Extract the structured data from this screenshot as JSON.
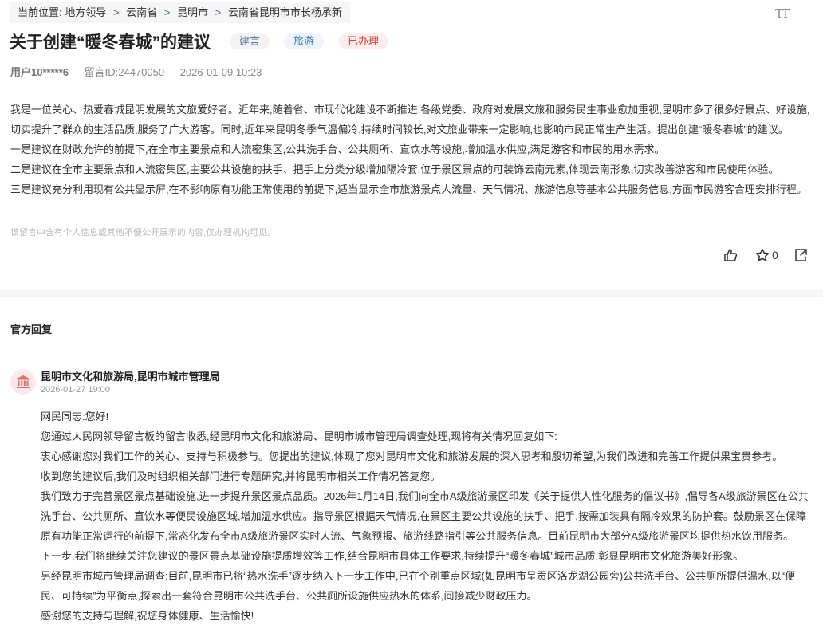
{
  "breadcrumb": {
    "label": "当前位置:",
    "items": [
      "地方领导",
      "云南省",
      "昆明市",
      "云南省昆明市市长杨承新"
    ],
    "separator": ">"
  },
  "font_toggle": "TT",
  "post": {
    "title": "关于创建“暖冬春城”的建议",
    "tags": [
      "建言",
      "旅游",
      "已办理"
    ],
    "user": "用户10*****6",
    "message_id": "留言ID:24470050",
    "datetime": "2026-01-09 10:23",
    "paragraphs": [
      "我是一位关心、热爱春城昆明发展的文旅爱好者。近年来,随着省、市现代化建设不断推进,各级党委、政府对发展文旅和服务民生事业愈加重视,昆明市多了很多好景点、好设施,切实提升了群众的生活品质,服务了广大游客。同时,近年来昆明冬季气温偏冷,持续时间较长,对文旅业带来一定影响,也影响市民正常生产生活。提出创建“暖冬春城”的建议。",
      "一是建议在财政允许的前提下,在全市主要景点和人流密集区,公共洗手台、公共厕所、直饮水等设施,增加温水供应,满足游客和市民的用水需求。",
      "二是建议在全市主要景点和人流密集区,主要公共设施的扶手、把手上分类分级增加隔冷套,位于景区景点的可装饰云南元素,体现云南形象,切实改善游客和市民使用体验。",
      "三是建议充分利用现有公共显示屏,在不影响原有功能正常使用的前提下,适当显示全市旅游景点人流量、天气情况、旅游信息等基本公共服务信息,方面市民游客合理安排行程。"
    ],
    "notice": "该留言中含有个人信息或其他不便公开展示的内容,仅办理机构可见。",
    "star_count": "0"
  },
  "reply": {
    "section_title": "官方回复",
    "org": "昆明市文化和旅游局,昆明市城市管理局",
    "datetime": "2026-01-27 19:00",
    "paragraphs": [
      "网民同志:您好!",
      "您通过人民网领导留言板的留言收悉,经昆明市文化和旅游局、昆明市城市管理局调查处理,现将有关情况回复如下:",
      "衷心感谢您对我们工作的关心、支持与积极参与。您提出的建议,体现了您对昆明市文化和旅游发展的深入思考和殷切希望,为我们改进和完善工作提供果宝贵参考。",
      "收到您的建议后,我们及时组织相关部门进行专题研究,并将昆明市相关工作情况答复您。",
      "我们致力于完善景区景点基础设施,进一步提升景区景点品质。2026年1月14日,我们向全市A级旅游景区印发《关于提供人性化服务的倡议书》,倡导各A级旅游景区在公共洗手台、公共厕所、直饮水等便民设施区域,增加温水供应。指导景区根据天气情况,在景区主要公共设施的扶手、把手,按需加装具有隔冷效果的防护套。鼓励景区在保障原有功能正常运行的前提下,常态化发布全市A级旅游景区实时人流、气象预报、旅游线路指引等公共服务信息。目前昆明市大部分A级旅游景区均提供热水饮用服务。",
      "下一步,我们将继续关注您建议的景区景点基础设施提质增效等工作,结合昆明市具体工作要求,持续提升“暖冬春城”城市品质,彰显昆明市文化旅游美好形象。",
      "另经昆明市城市管理局调查:目前,昆明市已将“热水洗手”逐步纳入下一步工作中,已在个别重点区域(如昆明市呈贡区洛龙湖公园旁)公共洗手台、公共厕所提供温水,以“便民、可持续”为平衡点,探索出一套符合昆明市公共洗手台、公共厕所设施供应热水的体系,间接减少财政压力。",
      "感谢您的支持与理解,祝您身体健康、生活愉快!"
    ]
  },
  "colors": {
    "tag_suggest": "#4a6d99",
    "tag_travel": "#3a79c4",
    "tag_done": "#e03d3d",
    "icon_gov": "#e26a6a"
  }
}
